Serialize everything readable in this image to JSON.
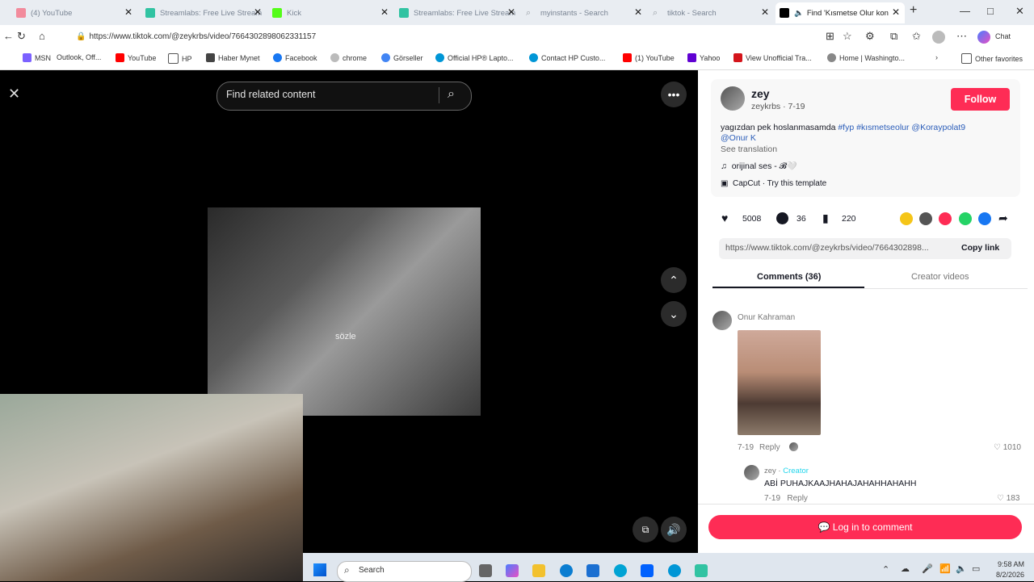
{
  "tabs": [
    {
      "label": "(4) YouTube",
      "color": "#f28b9c"
    },
    {
      "label": "Streamlabs: Free Live Stream",
      "color": "#31c3a2"
    },
    {
      "label": "Kick",
      "color": "#53fc18"
    },
    {
      "label": "Streamlabs: Free Live Stream",
      "color": "#31c3a2"
    },
    {
      "label": "myinstants - Search",
      "color": "#9aa0a6"
    },
    {
      "label": "tiktok - Search",
      "color": "#9aa0a6"
    },
    {
      "label": "Find 'Kısmetse Olur kon",
      "color": "#000000"
    }
  ],
  "window": {
    "new_tab": "+",
    "minimize": "—",
    "maximize": "□",
    "close": "✕"
  },
  "address": {
    "url": "https://www.tiktok.com/@zeykrbs/video/7664302898062331157"
  },
  "bookmarks": [
    {
      "label": "MSN",
      "color": "#7b61ff"
    },
    {
      "label": "Outlook, Off...",
      "color": "#0a64d8"
    },
    {
      "label": "YouTube",
      "color": "#ff0000"
    },
    {
      "label": "HP",
      "color": "#ffffff"
    },
    {
      "label": "Haber Mynet",
      "color": "#444444"
    },
    {
      "label": "Facebook",
      "color": "#1877f2"
    },
    {
      "label": "chrome",
      "color": "#bbbbbb"
    },
    {
      "label": "Görseller",
      "color": "#4285f4"
    },
    {
      "label": "Official HP® Lapto...",
      "color": "#0096d6"
    },
    {
      "label": "Contact HP Custo...",
      "color": "#0096d6"
    },
    {
      "label": "(1) YouTube",
      "color": "#ff0000"
    },
    {
      "label": "Yahoo",
      "color": "#6001d2"
    },
    {
      "label": "View Unofficial Tra...",
      "color": "#d4151b"
    },
    {
      "label": "Home | Washingto...",
      "color": "#888888"
    }
  ],
  "bookmarks_other": "Other favorites",
  "chat_label": "Chat",
  "video": {
    "search_placeholder": "Find related content",
    "caption": "sözle"
  },
  "post": {
    "display_name": "zey",
    "handle_date": "zeykrbs · 7-19",
    "follow_label": "Follow",
    "description": "yagızdan pek hoslanmasamda ",
    "tags": [
      "#fyp",
      "#kısmetseolur",
      "@Koraypolat9",
      "@Onur K"
    ],
    "see_translation": "See translation",
    "music": "orijinal ses - 𝓑🤍",
    "template": "CapCut · Try this template",
    "likes": "5008",
    "comments": "36",
    "saves": "220",
    "link": "https://www.tiktok.com/@zeykrbs/video/7664302898...",
    "copy_link": "Copy link"
  },
  "tabs_panel": {
    "comments": "Comments (36)",
    "creator": "Creator videos"
  },
  "comments": [
    {
      "author": "Onur Kahraman",
      "date": "7-19",
      "reply": "Reply",
      "likes": "1010"
    },
    {
      "author": "zey",
      "badge": "Creator",
      "text": "ABİ PUHAJKAAJHAHAJAHAHHAHAHH",
      "date": "7-19",
      "reply": "Reply",
      "likes": "183"
    }
  ],
  "login_comment": "Log in to comment",
  "taskbar": {
    "search": "Search",
    "time": "9:58 AM",
    "date": "8/2/2026"
  }
}
